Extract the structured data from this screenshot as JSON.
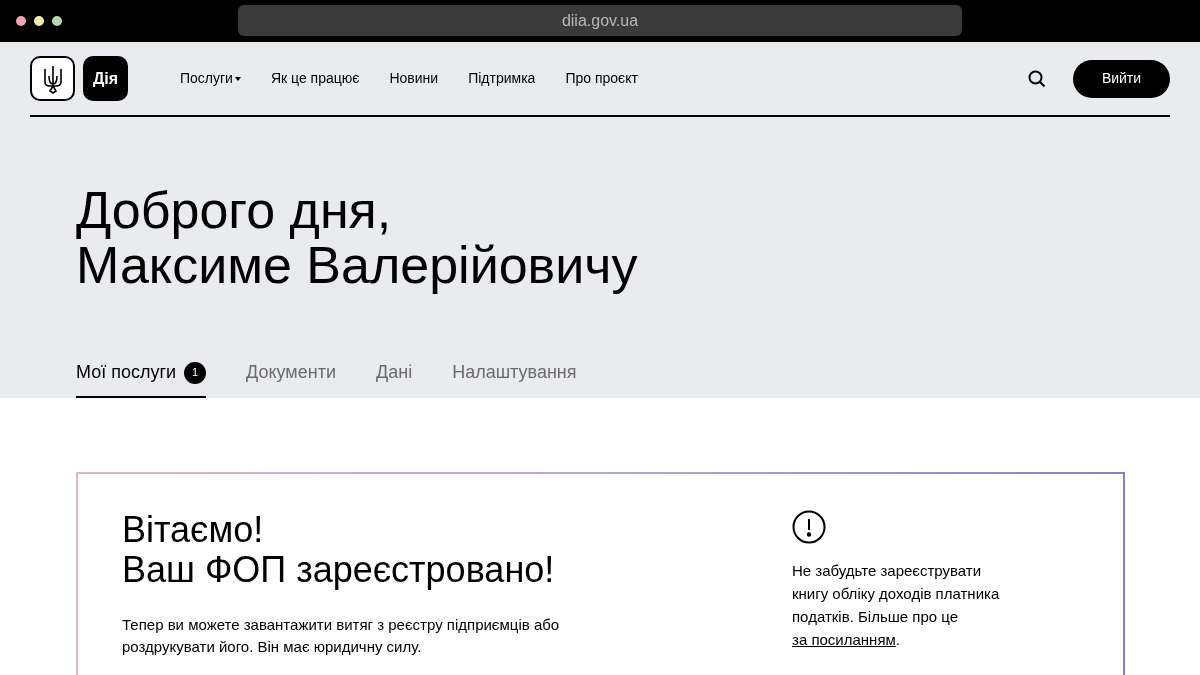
{
  "browser": {
    "address": "diia.gov.ua"
  },
  "header": {
    "logo_text": "Дія",
    "nav": [
      {
        "label": "Послуги",
        "dropdown": true
      },
      {
        "label": "Як це працює",
        "dropdown": false
      },
      {
        "label": "Новини",
        "dropdown": false
      },
      {
        "label": "Підтримка",
        "dropdown": false
      },
      {
        "label": "Про проєкт",
        "dropdown": false
      }
    ],
    "login_button": "Вийти"
  },
  "greeting": "Доброго дня,\nМаксиме Валерійовичу",
  "tabs": [
    {
      "label": "Мої послуги",
      "selected": true,
      "badge": "1"
    },
    {
      "label": "Документи",
      "selected": false
    },
    {
      "label": "Дані",
      "selected": false
    },
    {
      "label": "Налаштування",
      "selected": false
    }
  ],
  "card": {
    "title": "Вітаємо!\nВаш ФОП зареєстровано!",
    "text": "Тепер ви можете завантажити витяг з реєстру підприємців або роздрукувати його. Він має юридичну силу.",
    "note": {
      "text": "Не забудьте зареєструвати книгу обліку доходів платника податків. Більше про це ",
      "link": "за посиланням",
      "after": "."
    }
  }
}
